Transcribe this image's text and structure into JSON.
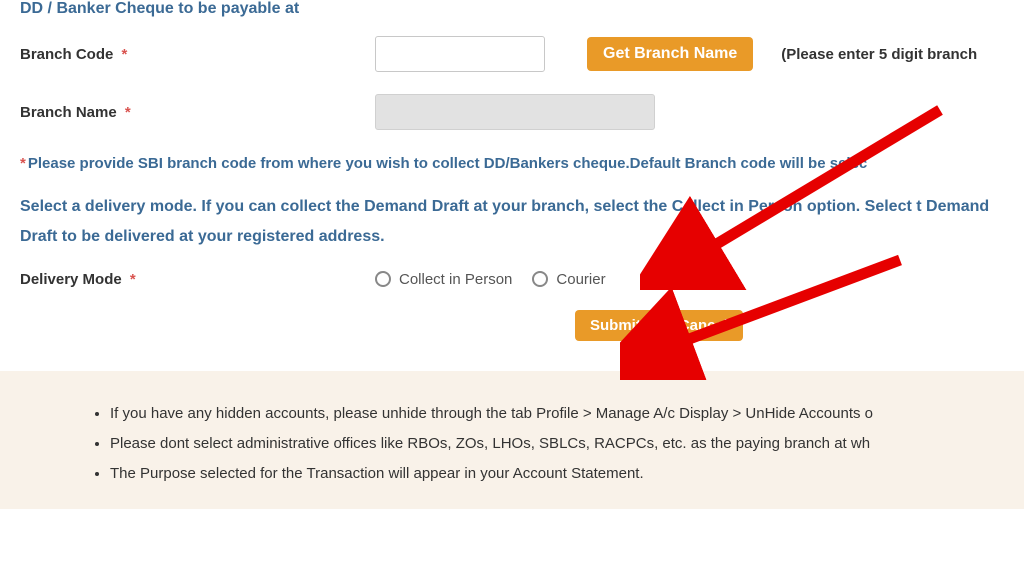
{
  "heading": "DD / Banker Cheque to be payable at",
  "branch_code": {
    "label": "Branch Code",
    "value": ""
  },
  "get_branch_btn": "Get Branch Name",
  "branch_code_hint": "(Please enter 5 digit branch",
  "branch_name": {
    "label": "Branch Name",
    "value": ""
  },
  "help_text": "Please provide SBI branch code from where you wish to collect DD/Bankers cheque.Default Branch code will be selec",
  "delivery_instruction": "Select a delivery mode. If you can collect the Demand Draft at your branch, select the Collect in Person option. Select t Demand Draft to be delivered at your registered address.",
  "delivery_mode": {
    "label": "Delivery Mode",
    "options": {
      "collect": "Collect in Person",
      "courier": "Courier"
    }
  },
  "buttons": {
    "submit": "Submit",
    "cancel": "Cancel"
  },
  "notes": [
    "If you have any hidden accounts, please unhide through the tab Profile > Manage A/c Display > UnHide Accounts o",
    "Please dont select administrative offices like RBOs, ZOs, LHOs, SBLCs, RACPCs, etc. as the paying branch at wh",
    "The Purpose selected for the Transaction will appear in your Account Statement."
  ]
}
